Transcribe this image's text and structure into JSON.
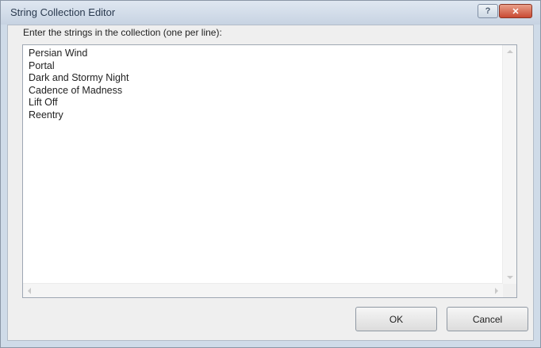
{
  "window": {
    "title": "String Collection Editor",
    "help_label": "?",
    "close_label": "✕"
  },
  "dialog": {
    "prompt": "Enter the strings in the collection (one per line):",
    "lines": [
      "Persian Wind",
      "Portal",
      "Dark and Stormy Night",
      "Cadence of Madness",
      "Lift Off",
      "Reentry"
    ],
    "ok_label": "OK",
    "cancel_label": "Cancel"
  },
  "icons": {
    "help": "question-mark-icon",
    "close": "close-icon",
    "scroll_up": "arrow-up-icon",
    "scroll_down": "arrow-down-icon",
    "scroll_left": "arrow-left-icon",
    "scroll_right": "arrow-right-icon"
  }
}
